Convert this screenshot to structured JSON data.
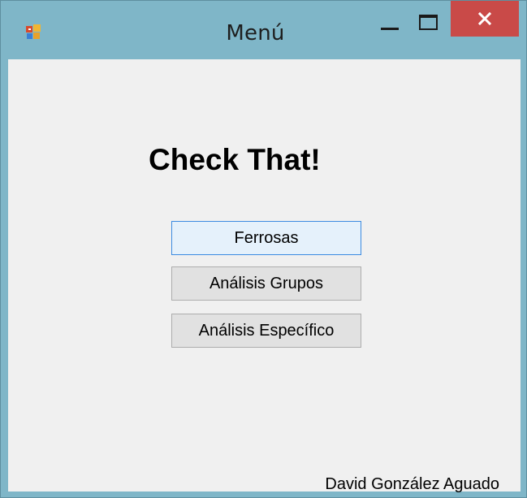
{
  "window": {
    "title": "Menú",
    "icon": "winforms-app-icon",
    "controls": {
      "minimize_icon": "minimize-icon",
      "maximize_icon": "maximize-icon",
      "close_icon": "close-icon"
    },
    "colors": {
      "frame": "#7fb6c8",
      "close_button": "#c94a48",
      "client": "#f0f0f0"
    }
  },
  "main": {
    "heading": "Check That!",
    "buttons": [
      {
        "label": "Ferrosas",
        "focused": true
      },
      {
        "label": "Análisis Grupos",
        "focused": false
      },
      {
        "label": "Análisis Específico",
        "focused": false
      }
    ],
    "author": "David González Aguado"
  }
}
